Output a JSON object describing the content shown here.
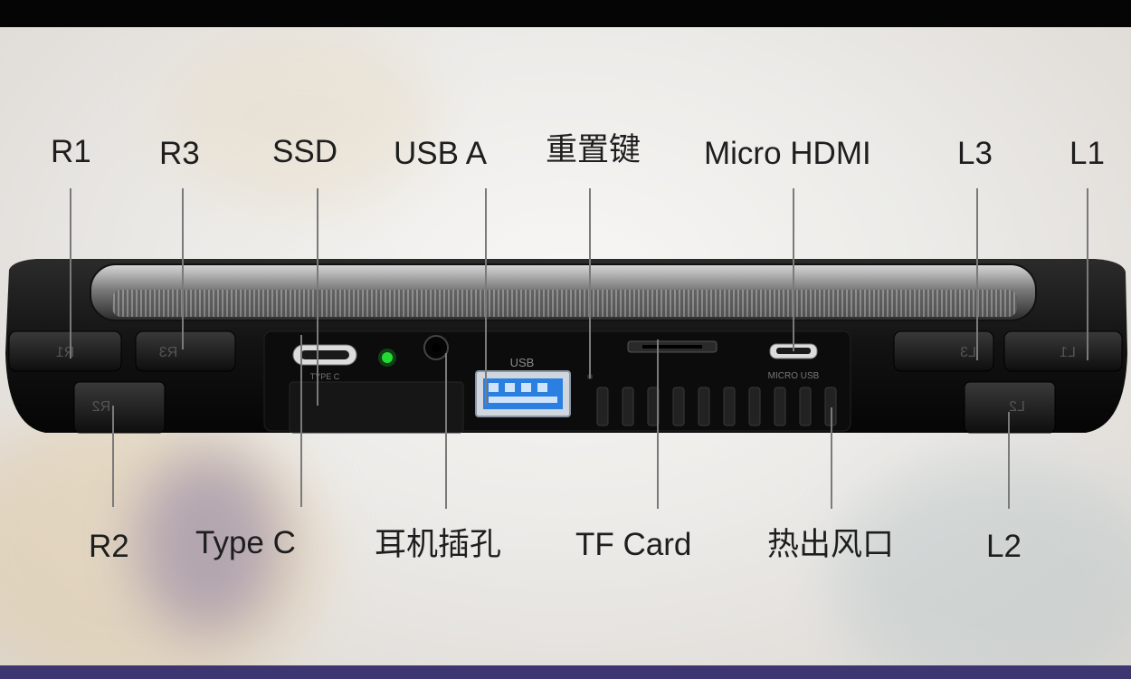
{
  "labels_top": {
    "r1": "R1",
    "r3": "R3",
    "ssd": "SSD",
    "usb_a": "USB A",
    "reset": "重置键",
    "micro_hdmi": "Micro HDMI",
    "l3": "L3",
    "l1": "L1"
  },
  "labels_bottom": {
    "r2": "R2",
    "type_c": "Type C",
    "headphone": "耳机插孔",
    "tf_card": "TF Card",
    "vent": "热出风口",
    "l2": "L2"
  },
  "device_print": {
    "type_c": "TYPE C",
    "usb": "USB",
    "micro_usb": "MICRO USB",
    "r1": "R1",
    "r3": "R3",
    "r2": "R2",
    "l3": "L3",
    "l1": "L1",
    "l2": "L2"
  },
  "colors": {
    "led": "#22dd33",
    "usb_port": "#2a7fe0",
    "body": "#141414",
    "footer": "#3d3670"
  }
}
